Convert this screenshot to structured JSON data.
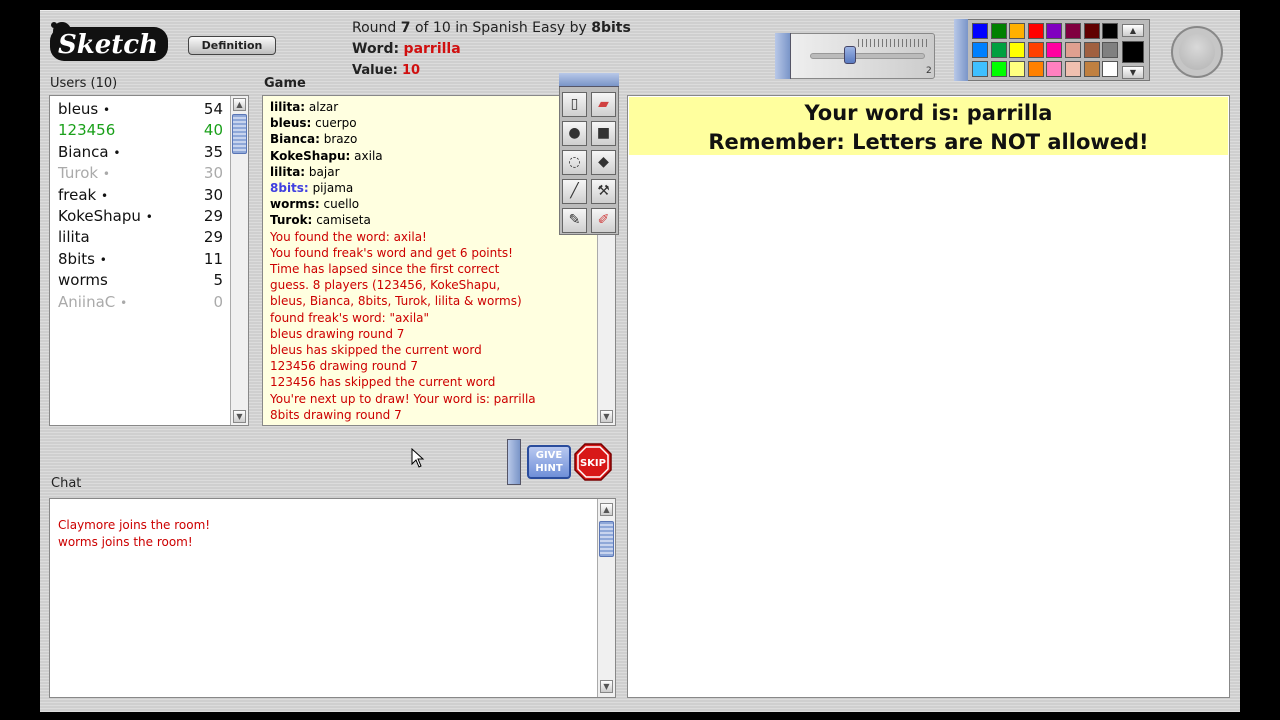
{
  "header": {
    "logo_text": "Sketch",
    "definition_button": "Definition",
    "round_prefix": "Round",
    "round_current": "7",
    "round_of": "of",
    "round_total": "10",
    "round_in": "in",
    "room": "Spanish Easy",
    "by": "by",
    "drawer": "8bits",
    "word_label": "Word:",
    "word": "parrilla",
    "value_label": "Value:",
    "value": "10"
  },
  "brush": {
    "size_label": "2"
  },
  "palette": {
    "colors": [
      "#0000ff",
      "#008000",
      "#ffb000",
      "#ff0000",
      "#8000c0",
      "#800040",
      "#600000",
      "#000000",
      "#0080ff",
      "#00a040",
      "#ffff00",
      "#ff4000",
      "#ff00a0",
      "#e0a090",
      "#a06040",
      "#808080",
      "#40c0ff",
      "#00ff00",
      "#ffff80",
      "#ff8000",
      "#ff80c0",
      "#f0c0b0",
      "#c08040",
      "#ffffff"
    ],
    "selected": "#000000"
  },
  "users": {
    "label": "Users (10)",
    "items": [
      {
        "name": "bleus",
        "dot": "•",
        "score": "54",
        "color": "#111111"
      },
      {
        "name": "123456",
        "dot": "",
        "score": "40",
        "color": "#1aa01a"
      },
      {
        "name": "Bianca",
        "dot": "•",
        "score": "35",
        "color": "#111111"
      },
      {
        "name": "Turok",
        "dot": "•",
        "score": "30",
        "color": "#aaaaaa"
      },
      {
        "name": "freak",
        "dot": "•",
        "score": "30",
        "color": "#111111"
      },
      {
        "name": "KokeShapu",
        "dot": "•",
        "score": "29",
        "color": "#111111"
      },
      {
        "name": "lilita",
        "dot": "",
        "score": "29",
        "color": "#111111"
      },
      {
        "name": "8bits",
        "dot": "•",
        "score": "11",
        "color": "#111111"
      },
      {
        "name": "worms",
        "dot": "",
        "score": "5",
        "color": "#111111"
      },
      {
        "name": "AniinaC",
        "dot": "•",
        "score": "0",
        "color": "#aaaaaa"
      }
    ]
  },
  "game": {
    "label": "Game",
    "log": [
      {
        "name": "lilita:",
        "text": "alzar",
        "style": "normal"
      },
      {
        "name": "bleus:",
        "text": "cuerpo",
        "style": "normal"
      },
      {
        "name": "Bianca:",
        "text": "brazo",
        "style": "normal"
      },
      {
        "name": "KokeShapu:",
        "text": "axila",
        "style": "normal"
      },
      {
        "name": "lilita:",
        "text": "bajar",
        "style": "normal"
      },
      {
        "name": "8bits:",
        "text": "pijama",
        "style": "blue"
      },
      {
        "name": "worms:",
        "text": "cuello",
        "style": "normal"
      },
      {
        "name": "Turok:",
        "text": "camiseta",
        "style": "normal"
      },
      {
        "name": "",
        "text": "You found the word: axila!",
        "style": "red"
      },
      {
        "name": "",
        "text": "You found freak's word and get 6 points!",
        "style": "red"
      },
      {
        "name": "",
        "text": "Time has lapsed since the first correct",
        "style": "red"
      },
      {
        "name": "",
        "text": "guess. 8 players (123456, KokeShapu,",
        "style": "red"
      },
      {
        "name": "",
        "text": "bleus, Bianca, 8bits, Turok, lilita & worms)",
        "style": "red"
      },
      {
        "name": "",
        "text": "found freak's word: \"axila\"",
        "style": "red"
      },
      {
        "name": "",
        "text": "bleus drawing round 7",
        "style": "red"
      },
      {
        "name": "",
        "text": "bleus has skipped the current word",
        "style": "red"
      },
      {
        "name": "",
        "text": "123456 drawing round 7",
        "style": "red"
      },
      {
        "name": "",
        "text": "123456 has skipped the current word",
        "style": "red"
      },
      {
        "name": "",
        "text": "You're next up to draw! Your word is: parrilla",
        "style": "red"
      },
      {
        "name": "",
        "text": "8bits drawing round 7",
        "style": "red"
      }
    ]
  },
  "actions": {
    "hint_label": "GIVE HINT",
    "skip_label": "SKIP"
  },
  "chat": {
    "label": "Chat",
    "messages": [
      "Claymore joins the room!",
      "worms joins the room!"
    ]
  },
  "canvas": {
    "banner_line1": "Your word is: parrilla",
    "banner_line2": "Remember: Letters are NOT allowed!"
  },
  "tools": [
    "new-page",
    "eraser",
    "ellipse",
    "rectangle",
    "lasso",
    "fill-bucket",
    "line",
    "hammer",
    "brush",
    "pen"
  ]
}
